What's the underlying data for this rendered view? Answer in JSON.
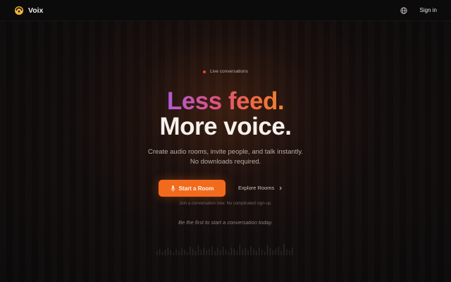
{
  "header": {
    "brand_name": "Voix",
    "logo_icon": "voix-logo-icon",
    "language_icon": "globe-icon",
    "signin_label": "Sign in"
  },
  "hero": {
    "badge_text": "Live conversations",
    "badge_color": "#e4492f",
    "title_line1": "Less feed.",
    "title_line2": "More voice.",
    "title_gradient": [
      "#b05ad7",
      "#e0537a",
      "#f06a3e",
      "#f0852f"
    ],
    "subtitle_line1": "Create audio rooms, invite people, and talk instantly.",
    "subtitle_line2": "No downloads required.",
    "primary_cta_label": "Start a Room",
    "primary_cta_icon": "microphone-icon",
    "primary_cta_color": "#f26b1d",
    "secondary_cta_label": "Explore Rooms",
    "secondary_cta_icon": "chevron-right-icon",
    "note": "Join a conversation now. No complicated sign-up.",
    "tagline": "Be the first to start a conversation today."
  },
  "colors": {
    "background": "#0b0a0a",
    "accent": "#f26b1d"
  }
}
